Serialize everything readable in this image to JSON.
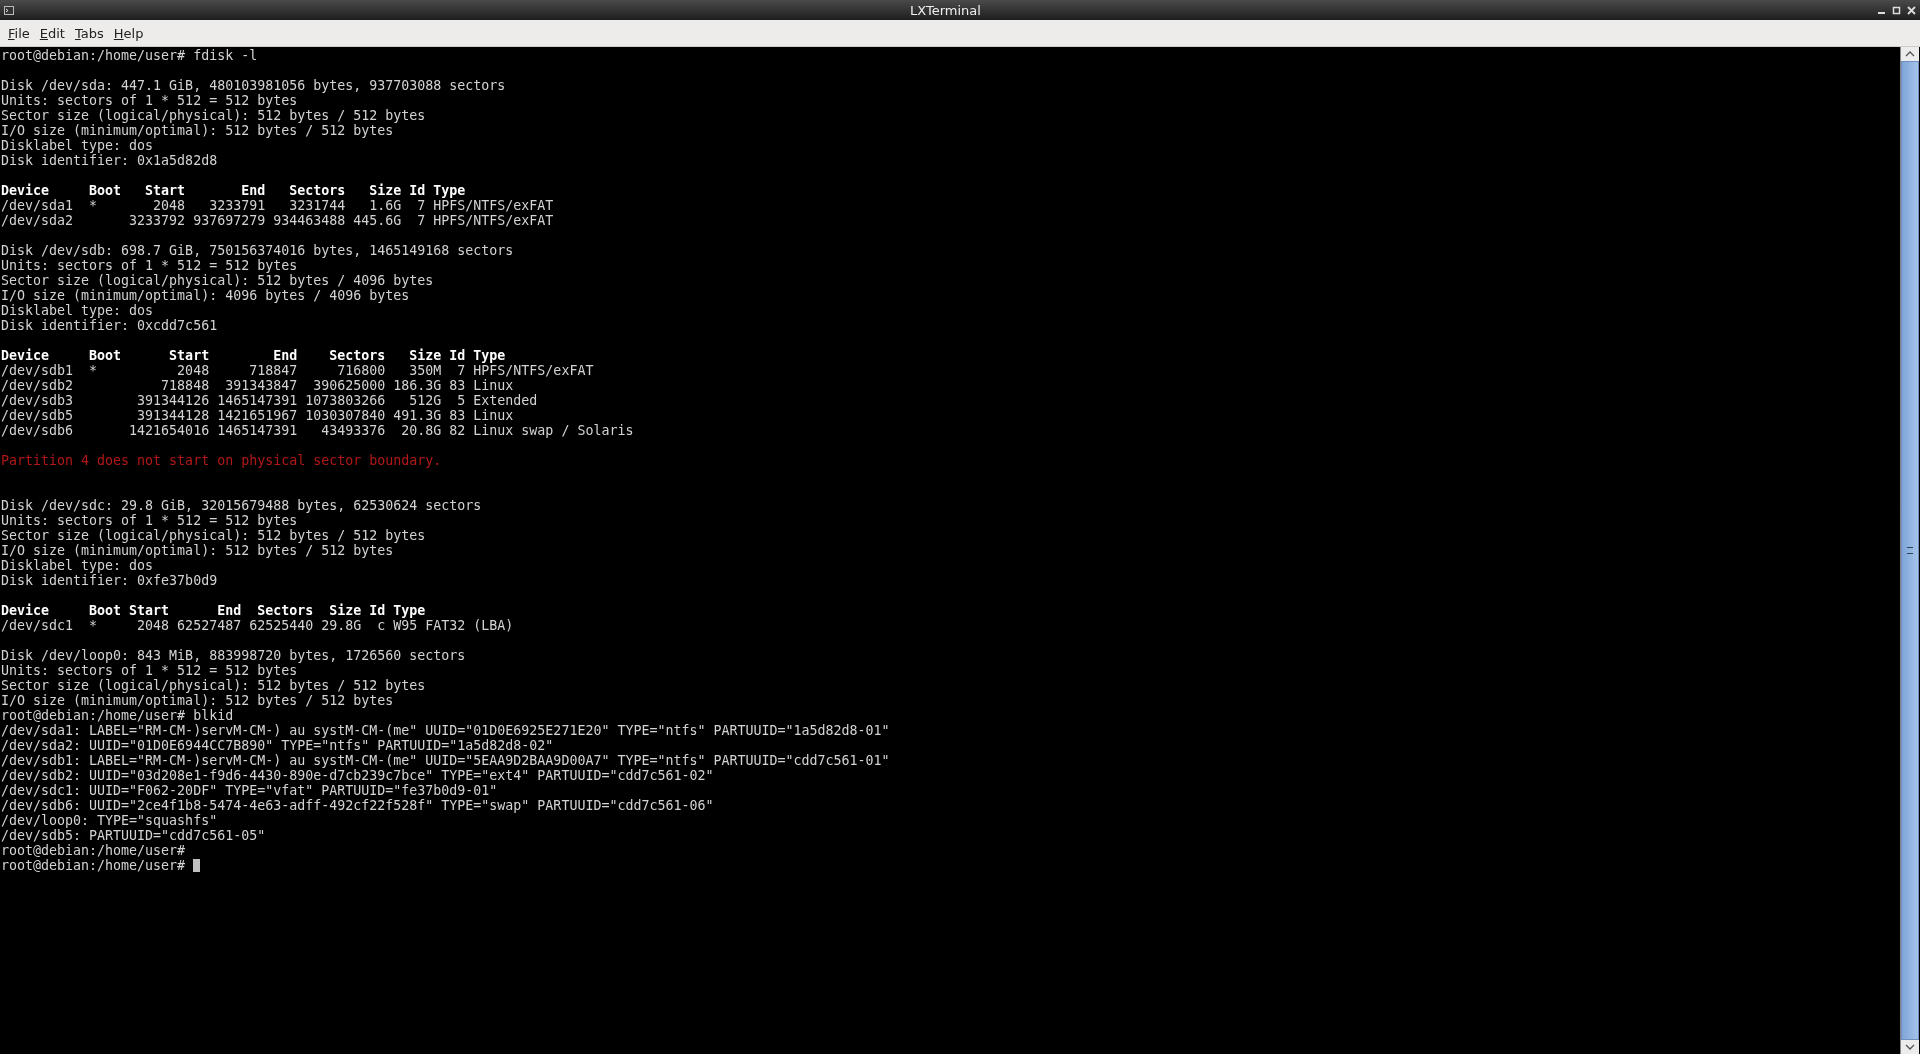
{
  "window": {
    "title": "LXTerminal"
  },
  "menu": [
    {
      "label": "File"
    },
    {
      "label": "Edit"
    },
    {
      "label": "Tabs"
    },
    {
      "label": "Help"
    }
  ],
  "terminal": {
    "lines": [
      {
        "kind": "prompt",
        "text": "root@debian:/home/user# fdisk -l",
        "cursor": false
      },
      {
        "kind": "blank"
      },
      {
        "kind": "output",
        "text": "Disk /dev/sda: 447.1 GiB, 480103981056 bytes, 937703088 sectors"
      },
      {
        "kind": "output",
        "text": "Units: sectors of 1 * 512 = 512 bytes"
      },
      {
        "kind": "output",
        "text": "Sector size (logical/physical): 512 bytes / 512 bytes"
      },
      {
        "kind": "output",
        "text": "I/O size (minimum/optimal): 512 bytes / 512 bytes"
      },
      {
        "kind": "output",
        "text": "Disklabel type: dos"
      },
      {
        "kind": "output",
        "text": "Disk identifier: 0x1a5d82d8"
      },
      {
        "kind": "blank"
      },
      {
        "kind": "header",
        "text": "Device     Boot   Start       End   Sectors   Size Id Type"
      },
      {
        "kind": "output",
        "text": "/dev/sda1  *       2048   3233791   3231744   1.6G  7 HPFS/NTFS/exFAT"
      },
      {
        "kind": "output",
        "text": "/dev/sda2       3233792 937697279 934463488 445.6G  7 HPFS/NTFS/exFAT"
      },
      {
        "kind": "blank"
      },
      {
        "kind": "output",
        "text": "Disk /dev/sdb: 698.7 GiB, 750156374016 bytes, 1465149168 sectors"
      },
      {
        "kind": "output",
        "text": "Units: sectors of 1 * 512 = 512 bytes"
      },
      {
        "kind": "output",
        "text": "Sector size (logical/physical): 512 bytes / 4096 bytes"
      },
      {
        "kind": "output",
        "text": "I/O size (minimum/optimal): 4096 bytes / 4096 bytes"
      },
      {
        "kind": "output",
        "text": "Disklabel type: dos"
      },
      {
        "kind": "output",
        "text": "Disk identifier: 0xcdd7c561"
      },
      {
        "kind": "blank"
      },
      {
        "kind": "header",
        "text": "Device     Boot      Start        End    Sectors   Size Id Type"
      },
      {
        "kind": "output",
        "text": "/dev/sdb1  *          2048     718847     716800   350M  7 HPFS/NTFS/exFAT"
      },
      {
        "kind": "output",
        "text": "/dev/sdb2           718848  391343847  390625000 186.3G 83 Linux"
      },
      {
        "kind": "output",
        "text": "/dev/sdb3        391344126 1465147391 1073803266   512G  5 Extended"
      },
      {
        "kind": "output",
        "text": "/dev/sdb5        391344128 1421651967 1030307840 491.3G 83 Linux"
      },
      {
        "kind": "output",
        "text": "/dev/sdb6       1421654016 1465147391   43493376  20.8G 82 Linux swap / Solaris"
      },
      {
        "kind": "blank"
      },
      {
        "kind": "error",
        "text": "Partition 4 does not start on physical sector boundary."
      },
      {
        "kind": "blank"
      },
      {
        "kind": "blank"
      },
      {
        "kind": "output",
        "text": "Disk /dev/sdc: 29.8 GiB, 32015679488 bytes, 62530624 sectors"
      },
      {
        "kind": "output",
        "text": "Units: sectors of 1 * 512 = 512 bytes"
      },
      {
        "kind": "output",
        "text": "Sector size (logical/physical): 512 bytes / 512 bytes"
      },
      {
        "kind": "output",
        "text": "I/O size (minimum/optimal): 512 bytes / 512 bytes"
      },
      {
        "kind": "output",
        "text": "Disklabel type: dos"
      },
      {
        "kind": "output",
        "text": "Disk identifier: 0xfe37b0d9"
      },
      {
        "kind": "blank"
      },
      {
        "kind": "header",
        "text": "Device     Boot Start      End  Sectors  Size Id Type"
      },
      {
        "kind": "output",
        "text": "/dev/sdc1  *     2048 62527487 62525440 29.8G  c W95 FAT32 (LBA)"
      },
      {
        "kind": "blank"
      },
      {
        "kind": "output",
        "text": "Disk /dev/loop0: 843 MiB, 883998720 bytes, 1726560 sectors"
      },
      {
        "kind": "output",
        "text": "Units: sectors of 1 * 512 = 512 bytes"
      },
      {
        "kind": "output",
        "text": "Sector size (logical/physical): 512 bytes / 512 bytes"
      },
      {
        "kind": "output",
        "text": "I/O size (minimum/optimal): 512 bytes / 512 bytes"
      },
      {
        "kind": "prompt",
        "text": "root@debian:/home/user# blkid",
        "cursor": false
      },
      {
        "kind": "output",
        "text": "/dev/sda1: LABEL=\"RM-CM-)servM-CM-) au systM-CM-(me\" UUID=\"01D0E6925E271E20\" TYPE=\"ntfs\" PARTUUID=\"1a5d82d8-01\""
      },
      {
        "kind": "output",
        "text": "/dev/sda2: UUID=\"01D0E6944CC7B890\" TYPE=\"ntfs\" PARTUUID=\"1a5d82d8-02\""
      },
      {
        "kind": "output",
        "text": "/dev/sdb1: LABEL=\"RM-CM-)servM-CM-) au systM-CM-(me\" UUID=\"5EAA9D2BAA9D00A7\" TYPE=\"ntfs\" PARTUUID=\"cdd7c561-01\""
      },
      {
        "kind": "output",
        "text": "/dev/sdb2: UUID=\"03d208e1-f9d6-4430-890e-d7cb239c7bce\" TYPE=\"ext4\" PARTUUID=\"cdd7c561-02\""
      },
      {
        "kind": "output",
        "text": "/dev/sdc1: UUID=\"F062-20DF\" TYPE=\"vfat\" PARTUUID=\"fe37b0d9-01\""
      },
      {
        "kind": "output",
        "text": "/dev/sdb6: UUID=\"2ce4f1b8-5474-4e63-adff-492cf22f528f\" TYPE=\"swap\" PARTUUID=\"cdd7c561-06\""
      },
      {
        "kind": "output",
        "text": "/dev/loop0: TYPE=\"squashfs\""
      },
      {
        "kind": "output",
        "text": "/dev/sdb5: PARTUUID=\"cdd7c561-05\""
      },
      {
        "kind": "prompt",
        "text": "root@debian:/home/user#",
        "cursor": false
      },
      {
        "kind": "prompt",
        "text": "root@debian:/home/user# ",
        "cursor": true
      }
    ]
  }
}
